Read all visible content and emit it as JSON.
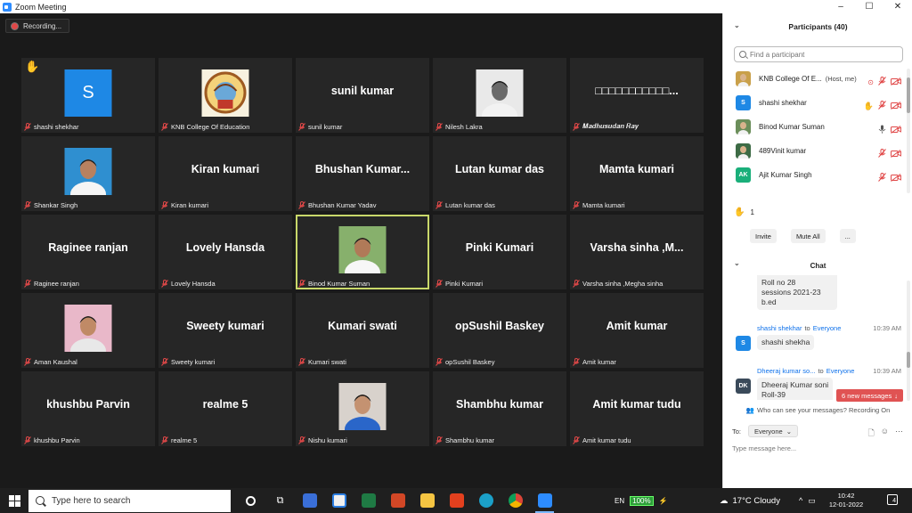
{
  "window": {
    "title": "Zoom Meeting",
    "controls": [
      "–",
      "☐",
      "✕"
    ]
  },
  "recording": {
    "label": "Recording..."
  },
  "tiles": [
    {
      "caption": "shashi shekhar",
      "kind": "avatar",
      "avatar_letter": "S",
      "hand": true,
      "active": false
    },
    {
      "caption": "KNB College Of Education",
      "kind": "photo",
      "photo": "logo",
      "active": false
    },
    {
      "caption": "sunil kumar",
      "kind": "text",
      "big": "sunil kumar",
      "active": false
    },
    {
      "caption": "Nilesh Lakra",
      "kind": "photo",
      "photo": "person-bw",
      "active": false
    },
    {
      "caption": "𝑴𝒂𝒅𝒉𝒖𝒔𝒖𝒅𝒂𝒏 𝑹𝒂𝒚",
      "kind": "text",
      "big": "□□□□□□□□□□□...",
      "active": false
    },
    {
      "caption": "Shankar Singh",
      "kind": "photo",
      "photo": "person-blue",
      "active": false
    },
    {
      "caption": "Kiran kumari",
      "kind": "text",
      "big": "Kiran kumari",
      "active": false
    },
    {
      "caption": "Bhushan Kumar Yadav",
      "kind": "text",
      "big": "Bhushan  Kumar...",
      "active": false
    },
    {
      "caption": "Lutan kumar das",
      "kind": "text",
      "big": "Lutan kumar das",
      "active": false
    },
    {
      "caption": "Mamta kumari",
      "kind": "text",
      "big": "Mamta kumari",
      "active": false
    },
    {
      "caption": "Raginee ranjan",
      "kind": "text",
      "big": "Raginee ranjan",
      "active": false
    },
    {
      "caption": "Lovely Hansda",
      "kind": "text",
      "big": "Lovely Hansda",
      "active": false
    },
    {
      "caption": "Binod Kumar Suman",
      "kind": "photo",
      "photo": "person-outdoor",
      "active": true
    },
    {
      "caption": "Pinki Kumari",
      "kind": "text",
      "big": "Pinki Kumari",
      "active": false
    },
    {
      "caption": "Varsha sinha ,Megha sinha",
      "kind": "text",
      "big": "Varsha sinha ,M...",
      "active": false
    },
    {
      "caption": "Aman Kaushal",
      "kind": "photo",
      "photo": "person-pink",
      "active": false
    },
    {
      "caption": "Sweety kumari",
      "kind": "text",
      "big": "Sweety kumari",
      "active": false
    },
    {
      "caption": "Kumari swati",
      "kind": "text",
      "big": "Kumari swati",
      "active": false
    },
    {
      "caption": "opSushil Baskey",
      "kind": "text",
      "big": "opSushil Baskey",
      "active": false
    },
    {
      "caption": "Amit kumar",
      "kind": "text",
      "big": "Amit kumar",
      "active": false
    },
    {
      "caption": "khushbu Parvin",
      "kind": "text",
      "big": "khushbu Parvin",
      "active": false
    },
    {
      "caption": "realme 5",
      "kind": "text",
      "big": "realme 5",
      "active": false
    },
    {
      "caption": "Nishu kumari",
      "kind": "photo",
      "photo": "person-selfie",
      "active": false
    },
    {
      "caption": "Shambhu kumar",
      "kind": "text",
      "big": "Shambhu kumar",
      "active": false
    },
    {
      "caption": "Amit kumar tudu",
      "kind": "text",
      "big": "Amit kumar tudu",
      "active": false
    }
  ],
  "participants": {
    "title": "Participants (40)",
    "search_placeholder": "Find a participant",
    "list": [
      {
        "name": "KNB College Of E...",
        "tag": "(Host, me)",
        "avatar": "logo",
        "color": "#c9a04a"
      },
      {
        "name": "shashi shekhar",
        "tag": "",
        "avatar": "S",
        "color": "#1e88e5",
        "hand": true
      },
      {
        "name": "Binod Kumar Suman",
        "tag": "",
        "avatar": "photo",
        "color": "#6b8e5a",
        "mic_on": true
      },
      {
        "name": "489Vinit kumar",
        "tag": "",
        "avatar": "photo",
        "color": "#3d6b45"
      },
      {
        "name": "Ajit Kumar Singh",
        "tag": "",
        "avatar": "AK",
        "color": "#1aaf7a"
      }
    ],
    "raised_hands": "1",
    "buttons": [
      "Invite",
      "Mute All",
      "..."
    ]
  },
  "chat": {
    "title": "Chat",
    "msg1_lines": [
      "Roll no 28",
      "sessions 2021-23",
      "b.ed"
    ],
    "msg2": {
      "from": "shashi shekhar",
      "to": "to",
      "target": "Everyone",
      "time": "10:39 AM",
      "text": "shashi shekha",
      "avatar": "S"
    },
    "msg3": {
      "from": "Dheeraj kumar so...",
      "to": "to",
      "target": "Everyone",
      "time": "10:39 AM",
      "text": "Dheeraj Kumar soni",
      "text2": "Roll-39",
      "avatar": "DK"
    },
    "new_messages": "6 new messages",
    "who_can_see": "Who can see your messages? Recording On",
    "to_label": "To:",
    "to_value": "Everyone",
    "input_placeholder": "Type message here..."
  },
  "taskbar": {
    "search_placeholder": "Type here to search",
    "lang": "EN",
    "battery": "100%",
    "weather": "17°C  Cloudy",
    "time": "10:42",
    "date": "12-01-2022",
    "notifications": "4"
  },
  "colors": {
    "active_tile_border": "#c9d86a",
    "muted_red": "#e04848",
    "chat_link": "#0e71eb",
    "new_msg_bg": "#e05353"
  }
}
